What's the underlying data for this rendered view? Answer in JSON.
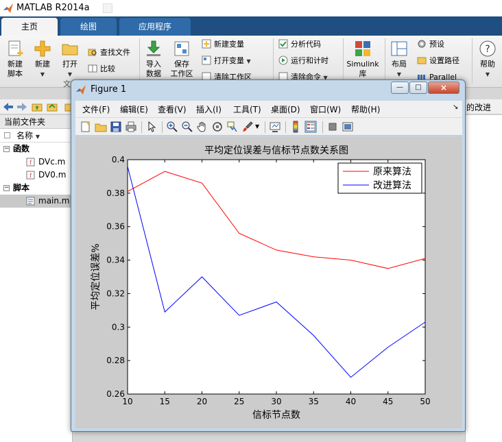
{
  "main_window": {
    "title": "MATLAB R2014a",
    "tabs": [
      "主页",
      "绘图",
      "应用程序"
    ],
    "ribbon": {
      "new_script": [
        "新建",
        "脚本"
      ],
      "new": "新建",
      "open": "打开",
      "find_files": "查找文件",
      "compare": "比较",
      "import": [
        "导入",
        "数据"
      ],
      "save": [
        "保存",
        "工作区"
      ],
      "new_variable": "新建变量",
      "open_variable": "打开变量",
      "clear_workspace": "清除工作区",
      "analyze_code": "分析代码",
      "run_and_time": "运行和计时",
      "clear_commands": "清除命令",
      "simulink": [
        "Simulink",
        "库"
      ],
      "layout": "布局",
      "preferences": "预设",
      "set_path": "设置路径",
      "parallel": "Parallel",
      "help": "帮助",
      "section_file": "文"
    },
    "current_folder_title": "当前文件夹",
    "address_right": "的改进",
    "file_header": "名称",
    "file_tree": {
      "functions_label": "函数",
      "functions": [
        "DVc.m",
        "DV0.m"
      ],
      "scripts_label": "脚本",
      "scripts": [
        "main.m"
      ]
    }
  },
  "figure_window": {
    "title": "Figure 1",
    "controls": {
      "minimize": "—",
      "maximize": "□",
      "close": "×"
    },
    "menu": [
      "文件(F)",
      "编辑(E)",
      "查看(V)",
      "插入(I)",
      "工具(T)",
      "桌面(D)",
      "窗口(W)",
      "帮助(H)"
    ],
    "menu_overflow": "↘"
  },
  "chart_data": {
    "type": "line",
    "title": "平均定位误差与信标节点数关系图",
    "xlabel": "信标节点数",
    "ylabel": "平均定位误差%",
    "x": [
      10,
      15,
      20,
      25,
      30,
      35,
      40,
      45,
      50
    ],
    "xlim": [
      10,
      50
    ],
    "ylim": [
      0.26,
      0.4
    ],
    "xticks": [
      10,
      15,
      20,
      25,
      30,
      35,
      40,
      45,
      50
    ],
    "yticks": [
      0.26,
      0.28,
      0.3,
      0.32,
      0.34,
      0.36,
      0.38,
      0.4
    ],
    "grid": false,
    "legend_position": "top-right",
    "series": [
      {
        "name": "原来算法",
        "color": "#ff0000",
        "values": [
          0.381,
          0.393,
          0.386,
          0.356,
          0.346,
          0.342,
          0.34,
          0.335,
          0.341
        ]
      },
      {
        "name": "改进算法",
        "color": "#0000ff",
        "values": [
          0.396,
          0.309,
          0.33,
          0.307,
          0.315,
          0.295,
          0.27,
          0.288,
          0.303
        ]
      }
    ]
  }
}
